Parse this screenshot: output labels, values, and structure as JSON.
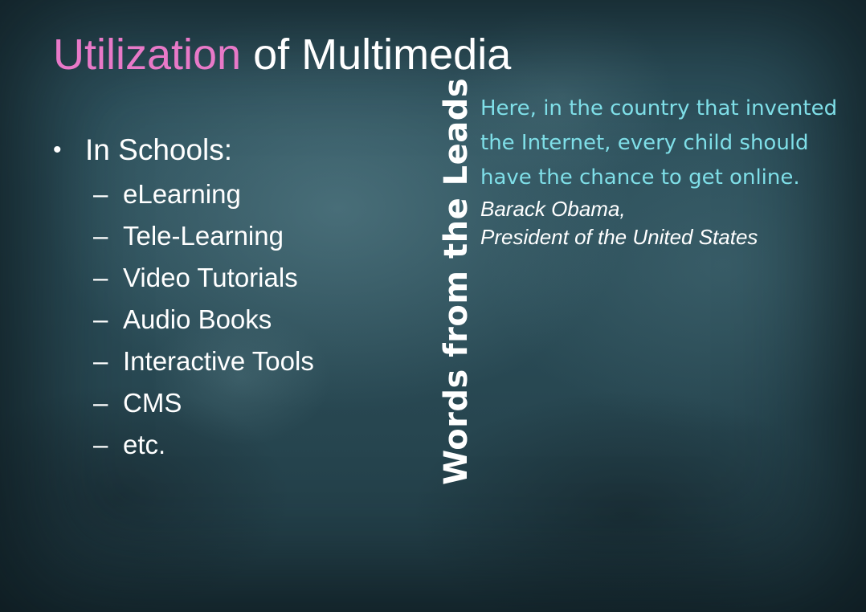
{
  "slide": {
    "title_accent": "Utilization",
    "title_rest": " of Multimedia",
    "bullet": {
      "marker": "•",
      "label": "In Schools:",
      "sub_marker": "–",
      "sub_items": [
        "eLearning",
        "Tele-Learning",
        "Video Tutorials",
        "Audio Books",
        "Interactive Tools",
        "CMS",
        "etc."
      ]
    },
    "side_heading": "Words from the Leads",
    "quote": {
      "text": "Here, in the country that invented the Internet, every child should have the chance to get online.",
      "author": "Barack Obama,",
      "author_title": "President of the United States"
    }
  },
  "colors": {
    "accent_pink": "#e879c8",
    "quote_cyan": "#7fdfe8",
    "text_white": "#ffffff",
    "background": "#2b4d58"
  }
}
